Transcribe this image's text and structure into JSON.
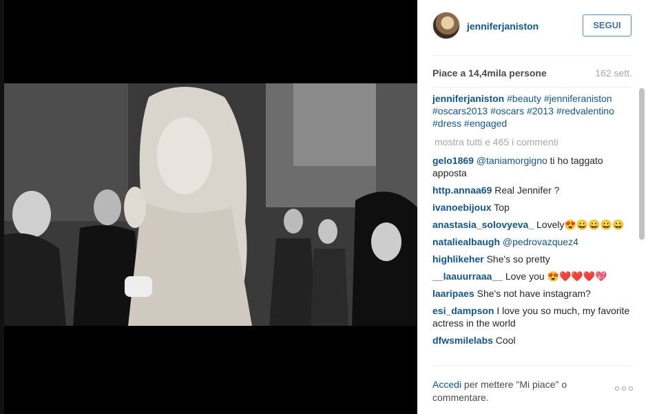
{
  "post": {
    "username": "jenniferjaniston",
    "follow_label": "SEGUI",
    "likes_text": "Piace a 14,4mila persone",
    "time_ago": "162 sett.",
    "caption": {
      "user": "jenniferjaniston",
      "hashtags": [
        "#beauty",
        "#jenniferaniston",
        "#oscars2013",
        "#oscars",
        "#2013",
        "#redvalentino",
        "#dress",
        "#engaged"
      ]
    },
    "show_all_comments": "mostra tutti e 465 i commenti"
  },
  "comments": [
    {
      "user": "gelo1869",
      "mention": "@taniamorgigno",
      "text": " ti ho taggato apposta"
    },
    {
      "user": "http.annaa69",
      "mention": "",
      "text": " Real Jennifer ?"
    },
    {
      "user": "ivanoebijoux",
      "mention": "",
      "text": " Top"
    },
    {
      "user": "anastasia_solovyeva_",
      "mention": "",
      "text": " Lovely😍😀😀😀😀"
    },
    {
      "user": "nataliealbaugh",
      "mention": "@pedrovazquez4",
      "text": ""
    },
    {
      "user": "highlikeher",
      "mention": "",
      "text": " She's so pretty"
    },
    {
      "user": "__laauurraaa__",
      "mention": "",
      "text": " Love you 😍❤️❤️❤️💖"
    },
    {
      "user": "laaripaes",
      "mention": "",
      "text": " She's not have instagram?"
    },
    {
      "user": "esi_dampson",
      "mention": "",
      "text": " I love you so much, my favorite actress in the world"
    },
    {
      "user": "dfwsmilelabs",
      "mention": "",
      "text": " Cool"
    }
  ],
  "footer": {
    "login_link": "Accedi",
    "login_text": " per mettere \"Mi piace\" o commentare."
  },
  "colors": {
    "link": "#125688",
    "button_border": "#4e8fc6",
    "muted": "#a5a7aa"
  },
  "icons": {
    "options": "more-dots-icon"
  }
}
